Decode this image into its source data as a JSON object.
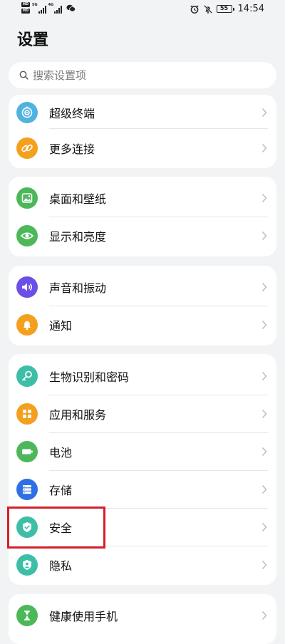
{
  "status_bar": {
    "network_1": "5G",
    "network_2": "4G",
    "hd_label": "HD",
    "battery": "55",
    "time": "14:54"
  },
  "page": {
    "title": "设置"
  },
  "search": {
    "placeholder": "搜索设置项"
  },
  "groups": [
    {
      "items": [
        {
          "label": "超级终端",
          "icon": "super-device-icon",
          "color": "#4fb3de"
        },
        {
          "label": "更多连接",
          "icon": "link-icon",
          "color": "#f4a01e"
        }
      ]
    },
    {
      "items": [
        {
          "label": "桌面和壁纸",
          "icon": "wallpaper-icon",
          "color": "#4cb85a"
        },
        {
          "label": "显示和亮度",
          "icon": "eye-icon",
          "color": "#4cb85a"
        }
      ]
    },
    {
      "items": [
        {
          "label": "声音和振动",
          "icon": "speaker-icon",
          "color": "#6c4ee8"
        },
        {
          "label": "通知",
          "icon": "bell-icon",
          "color": "#f4a01e"
        }
      ]
    },
    {
      "items": [
        {
          "label": "生物识别和密码",
          "icon": "key-icon",
          "color": "#3cbfa6"
        },
        {
          "label": "应用和服务",
          "icon": "apps-icon",
          "color": "#f4a01e"
        },
        {
          "label": "电池",
          "icon": "battery-icon",
          "color": "#4cb85a"
        },
        {
          "label": "存储",
          "icon": "storage-icon",
          "color": "#2f6fe6"
        },
        {
          "label": "安全",
          "icon": "shield-icon",
          "color": "#3cbfa6"
        },
        {
          "label": "隐私",
          "icon": "privacy-icon",
          "color": "#3cbfa6"
        }
      ]
    },
    {
      "items": [
        {
          "label": "健康使用手机",
          "icon": "hourglass-icon",
          "color": "#4cb85a"
        }
      ]
    }
  ]
}
